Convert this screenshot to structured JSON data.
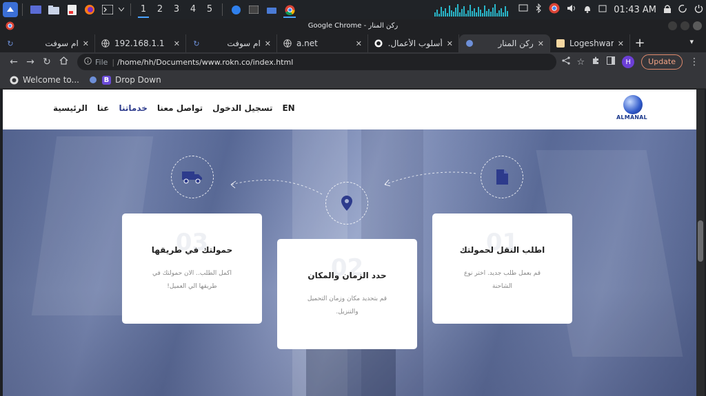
{
  "os": {
    "workspaces": [
      "1",
      "2",
      "3",
      "4",
      "5"
    ],
    "active_workspace": "1",
    "clock": "01:43 AM"
  },
  "window": {
    "title": "Google Chrome - ركن المنار"
  },
  "tabs": [
    {
      "title": "ام سوفت",
      "rtl": true,
      "active": false
    },
    {
      "title": "192.168.1.1",
      "rtl": false,
      "active": false
    },
    {
      "title": "ام سوفت",
      "rtl": true,
      "active": false
    },
    {
      "title": "a.net",
      "rtl": false,
      "active": false
    },
    {
      "title": "أسلوب الأعمال.",
      "rtl": true,
      "active": false
    },
    {
      "title": "ركن المنار",
      "rtl": true,
      "active": true
    },
    {
      "title": "Logeshwaran.co",
      "rtl": false,
      "active": false
    }
  ],
  "toolbar": {
    "file_label": "File",
    "url": "/home/hh/Documents/www.rokn.co/index.html",
    "profile_initial": "H",
    "update_label": "Update"
  },
  "bookmarks": [
    {
      "label": "Welcome to..."
    },
    {
      "label": "Drop Down",
      "icon_letter": "B"
    }
  ],
  "site": {
    "logo_text": "ALMANAL",
    "nav": [
      "الرئيسية",
      "عنا",
      "خدماتنا",
      "تواصل معنا",
      "تسجيل الدخول",
      "EN"
    ],
    "active_nav": "خدماتنا",
    "cards": [
      {
        "num": "01",
        "title": "اطلب النقل لحمولتك",
        "text": "قم بعمل طلب جديد. اختر نوع الشاحنة"
      },
      {
        "num": "02",
        "title": "حدد الزمان والمكان",
        "text": "قم بتحديد مكان وزمان التحميل والتنزيل."
      },
      {
        "num": "03",
        "title": "حمولتك في طريقها",
        "text": "اكمل الطلب.. الان حمولتك في طريقها الي العميل!"
      }
    ]
  },
  "icons": {
    "step1": "document-icon",
    "step2": "map-pin-icon",
    "step3": "truck-icon"
  },
  "colors": {
    "accent": "#2d3b8c",
    "update_border": "#e08a6c"
  }
}
